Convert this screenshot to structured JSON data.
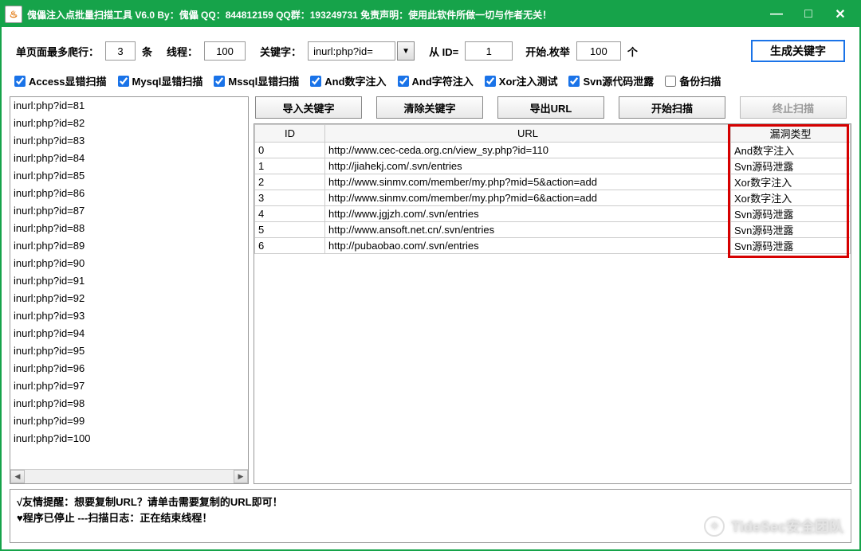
{
  "window": {
    "title": "傀儡注入点批量扫描工具  V6.0    By：傀儡    QQ：844812159    QQ群：193249731    免责声明：使用此软件所做一切与作者无关！"
  },
  "toolbar": {
    "pages_label": "单页面最多爬行：",
    "pages_value": "3",
    "pages_unit": "条",
    "threads_label": "线程：",
    "threads_value": "100",
    "keyword_label": "关键字：",
    "keyword_value": "inurl:php?id=",
    "from_id_label": "从 ID=",
    "from_id_value": "1",
    "enum_label": "开始.枚举",
    "enum_count": "100",
    "enum_unit": "个",
    "gen_button": "生成关键字"
  },
  "checks": {
    "access": "Access显错扫描",
    "mysql": "Mysql显错扫描",
    "mssql": "Mssql显错扫描",
    "and_num": "And数字注入",
    "and_char": "And字符注入",
    "xor": "Xor注入测试",
    "svn": "Svn源代码泄露",
    "backup": "备份扫描"
  },
  "left_list": [
    "inurl:php?id=81",
    "inurl:php?id=82",
    "inurl:php?id=83",
    "inurl:php?id=84",
    "inurl:php?id=85",
    "inurl:php?id=86",
    "inurl:php?id=87",
    "inurl:php?id=88",
    "inurl:php?id=89",
    "inurl:php?id=90",
    "inurl:php?id=91",
    "inurl:php?id=92",
    "inurl:php?id=93",
    "inurl:php?id=94",
    "inurl:php?id=95",
    "inurl:php?id=96",
    "inurl:php?id=97",
    "inurl:php?id=98",
    "inurl:php?id=99",
    "inurl:php?id=100"
  ],
  "buttons": {
    "import": "导入关键字",
    "clear": "清除关键字",
    "export": "导出URL",
    "start": "开始扫描",
    "stop": "终止扫描"
  },
  "table": {
    "headers": {
      "id": "ID",
      "url": "URL",
      "type": "漏洞类型"
    },
    "rows": [
      {
        "id": "0",
        "url": "http://www.cec-ceda.org.cn/view_sy.php?id=110",
        "type": "And数字注入"
      },
      {
        "id": "1",
        "url": "http://jiahekj.com/.svn/entries",
        "type": "Svn源码泄露"
      },
      {
        "id": "2",
        "url": "http://www.sinmv.com/member/my.php?mid=5&action=add",
        "type": "Xor数字注入"
      },
      {
        "id": "3",
        "url": "http://www.sinmv.com/member/my.php?mid=6&action=add",
        "type": "Xor数字注入"
      },
      {
        "id": "4",
        "url": "http://www.jgjzh.com/.svn/entries",
        "type": "Svn源码泄露"
      },
      {
        "id": "5",
        "url": "http://www.ansoft.net.cn/.svn/entries",
        "type": "Svn源码泄露"
      },
      {
        "id": "6",
        "url": "http://pubaobao.com/.svn/entries",
        "type": "Svn源码泄露"
      }
    ]
  },
  "status": {
    "line1": "√友情提醒：想要复制URL？请单击需要复制的URL即可！",
    "line2": "♥程序已停止 ---扫描日志：正在结束线程！"
  },
  "watermark": "TideSec安全团队"
}
